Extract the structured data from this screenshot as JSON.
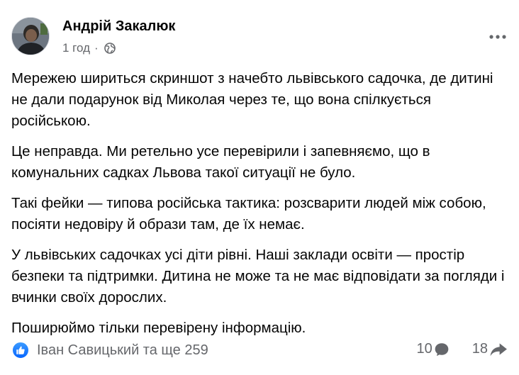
{
  "post": {
    "author": "Андрій Закалюк",
    "time": "1 год",
    "separator": "·",
    "paragraphs": [
      "Мережею шириться скриншот з начебто львівського садочка, де дитині не дали подарунок від Миколая через те, що вона спілкується російською.",
      "Це неправда. Ми ретельно усе перевірили і запевняємо, що в комунальних садках Львова такої ситуації не було.",
      "Такі фейки — типова російська тактика: розсварити людей між собою, посіяти недовіру й образи там, де їх немає.",
      "У львівських садочках усі діти рівні. Наші заклади освіти — простір безпеки та підтримки. Дитина не може та не має відповідати за погляди і вчинки своїх дорослих.",
      "Поширюймо тільки перевірену інформацію."
    ],
    "reactions_text": "Іван Савицький та ще 259",
    "comments_count": "10",
    "shares_count": "18"
  },
  "icons": {
    "like": "like-icon",
    "globe": "globe-icon",
    "more": "more-options-icon",
    "comment": "comment-icon",
    "share": "share-icon"
  },
  "colors": {
    "text": "#050505",
    "secondary": "#65676b",
    "like_blue": "#0866ff"
  }
}
